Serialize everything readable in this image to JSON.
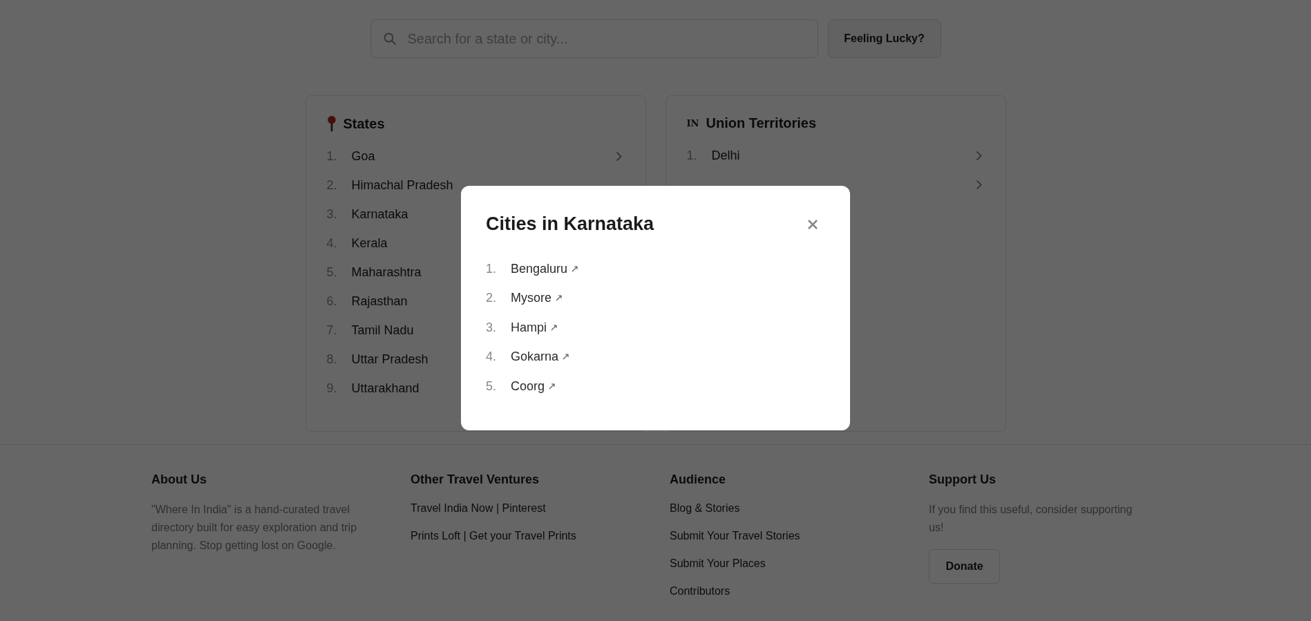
{
  "search": {
    "placeholder": "Search for a state or city..."
  },
  "lucky_button": "Feeling Lucky?",
  "cards": [
    {
      "kind": "pin",
      "title": "States",
      "items": [
        {
          "number": "1.",
          "name": "Goa",
          "chevron": true
        },
        {
          "number": "2.",
          "name": "Himachal Pradesh",
          "chevron": false
        },
        {
          "number": "3.",
          "name": "Karnataka",
          "chevron": false
        },
        {
          "number": "4.",
          "name": "Kerala",
          "chevron": false
        },
        {
          "number": "5.",
          "name": "Maharashtra",
          "chevron": false
        },
        {
          "number": "6.",
          "name": "Rajasthan",
          "chevron": false
        },
        {
          "number": "7.",
          "name": "Tamil Nadu",
          "chevron": false
        },
        {
          "number": "8.",
          "name": "Uttar Pradesh",
          "chevron": false
        },
        {
          "number": "9.",
          "name": "Uttarakhand",
          "chevron": false
        }
      ]
    },
    {
      "kind": "flag",
      "flag_text": "IN",
      "title": "Union Territories",
      "items": [
        {
          "number": "1.",
          "name": "Delhi",
          "chevron": true
        },
        {
          "chevron": true
        }
      ]
    }
  ],
  "footer": [
    {
      "kind": "text",
      "heading": "About Us",
      "text": "\"Where In India\" is a hand-curated travel directory built for easy exploration and trip planning. Stop getting lost on Google."
    },
    {
      "kind": "links",
      "heading": "Other Travel Ventures",
      "links": [
        "Travel India Now | Pinterest",
        "Prints Loft | Get your Travel Prints"
      ]
    },
    {
      "kind": "links",
      "heading": "Audience",
      "links": [
        "Blog & Stories",
        "Submit Your Travel Stories",
        "Submit Your Places",
        "Contributors"
      ]
    },
    {
      "kind": "button",
      "heading": "Support Us",
      "text": "If you find this useful, consider supporting us!",
      "button": "Donate"
    }
  ],
  "modal": {
    "title": "Cities in Karnataka",
    "cities": [
      {
        "number": "1.",
        "name": "Bengaluru"
      },
      {
        "number": "2.",
        "name": "Mysore"
      },
      {
        "number": "3.",
        "name": "Hampi"
      },
      {
        "number": "4.",
        "name": "Gokarna"
      },
      {
        "number": "5.",
        "name": "Coorg"
      }
    ]
  }
}
